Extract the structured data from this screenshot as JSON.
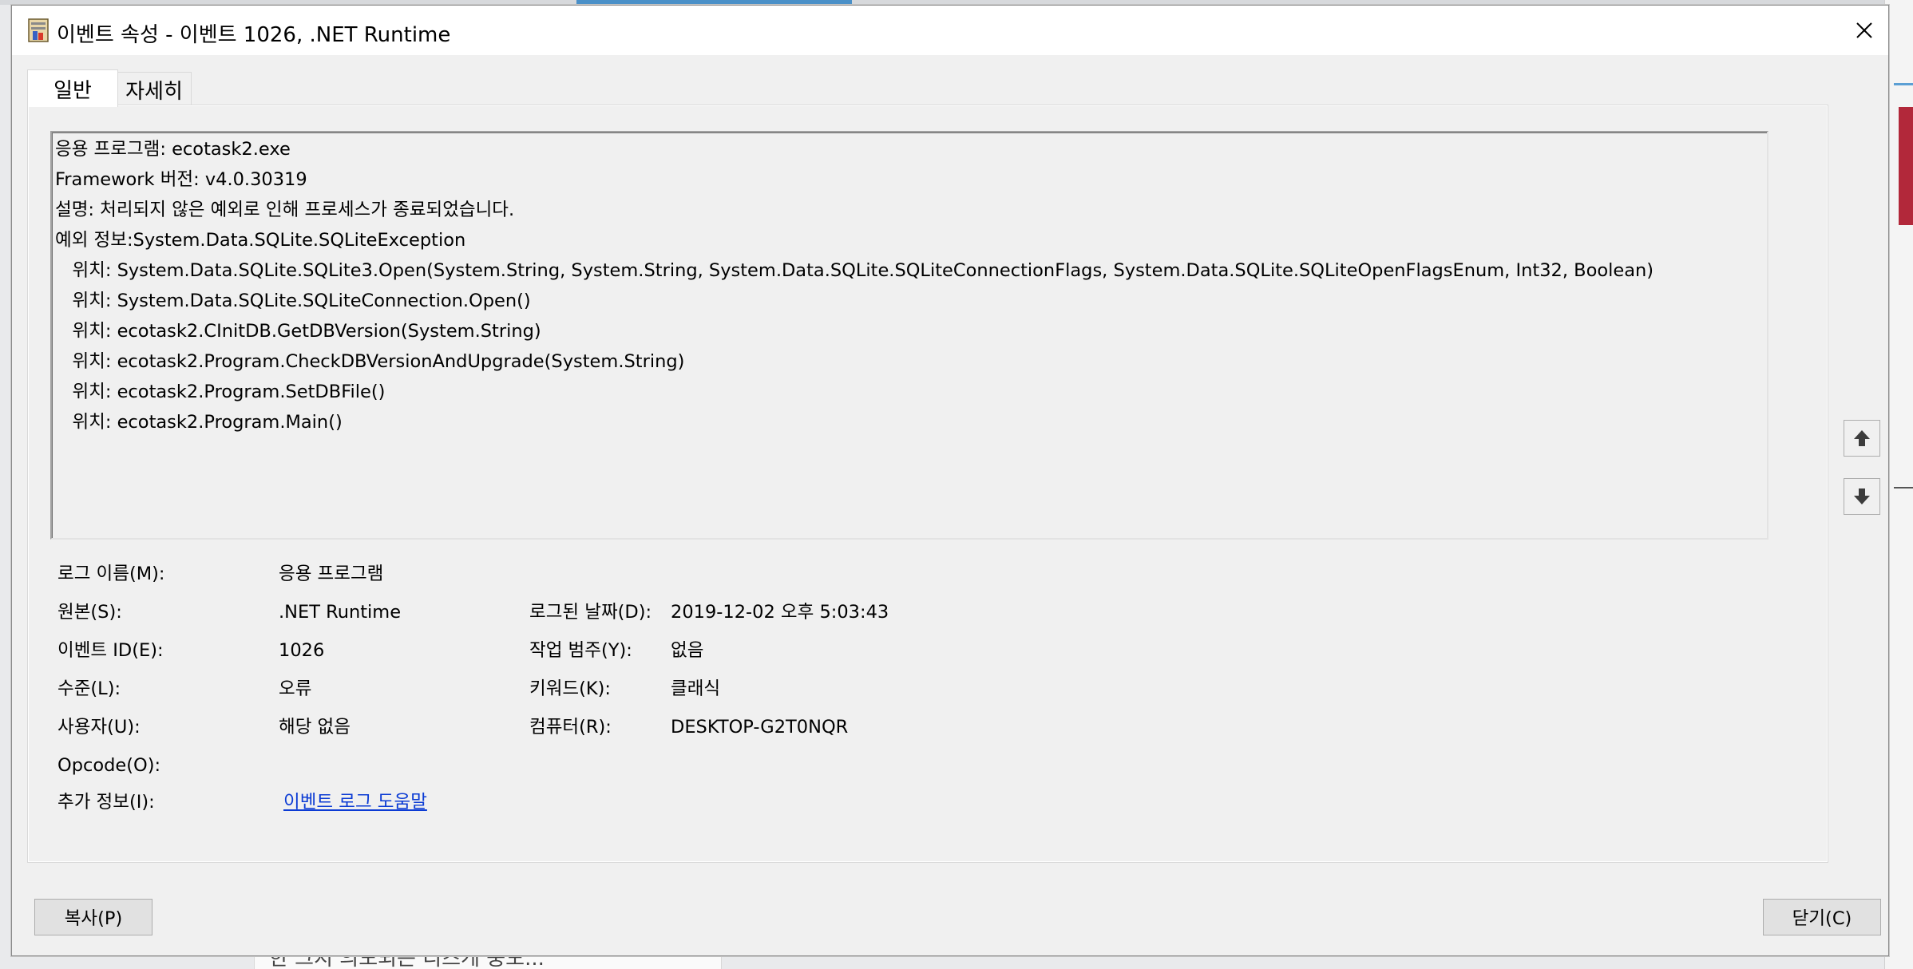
{
  "background": {
    "bottom_card_text": "한 그지 의도되는 디즈게 중도..."
  },
  "window": {
    "title": "이벤트 속성 - 이벤트 1026, .NET Runtime",
    "icon": "event-viewer-icon",
    "close_icon": "close-icon"
  },
  "tabs": [
    {
      "label": "일반",
      "active": true
    },
    {
      "label": "자세히",
      "active": false
    }
  ],
  "description": {
    "lines": [
      "응용 프로그램: ecotask2.exe",
      "Framework 버전: v4.0.30319",
      "설명: 처리되지 않은 예외로 인해 프로세스가 종료되었습니다.",
      "예외 정보:System.Data.SQLite.SQLiteException",
      "   위치: System.Data.SQLite.SQLite3.Open(System.String, System.String, System.Data.SQLite.SQLiteConnectionFlags, System.Data.SQLite.SQLiteOpenFlagsEnum, Int32, Boolean)",
      "   위치: System.Data.SQLite.SQLiteConnection.Open()",
      "   위치: ecotask2.CInitDB.GetDBVersion(System.String)",
      "   위치: ecotask2.Program.CheckDBVersionAndUpgrade(System.String)",
      "   위치: ecotask2.Program.SetDBFile()",
      "   위치: ecotask2.Program.Main()"
    ]
  },
  "fields": {
    "log_name_label": "로그 이름(M):",
    "log_name_value": "응용 프로그램",
    "source_label": "원본(S):",
    "source_value": ".NET Runtime",
    "logged_label": "로그된 날짜(D):",
    "logged_value": "2019-12-02 오후 5:03:43",
    "event_id_label": "이벤트 ID(E):",
    "event_id_value": "1026",
    "task_category_label": "작업 범주(Y):",
    "task_category_value": "없음",
    "level_label": "수준(L):",
    "level_value": "오류",
    "keywords_label": "키워드(K):",
    "keywords_value": "클래식",
    "user_label": "사용자(U):",
    "user_value": "해당 없음",
    "computer_label": "컴퓨터(R):",
    "computer_value": "DESKTOP-G2T0NQR",
    "opcode_label": "Opcode(O):",
    "opcode_value": "",
    "more_info_label": "추가 정보(I):",
    "more_info_link": "이벤트 로그 도움말"
  },
  "nav": {
    "up_icon": "arrow-up-icon",
    "down_icon": "arrow-down-icon"
  },
  "buttons": {
    "copy_label": "복사(P)",
    "close_label": "닫기(C)"
  }
}
